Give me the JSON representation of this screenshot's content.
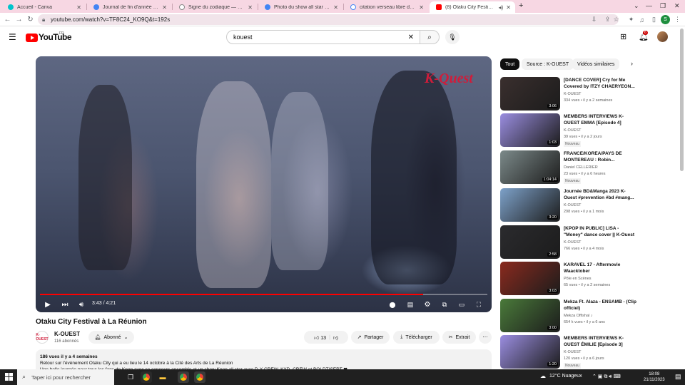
{
  "browser": {
    "tabs": [
      {
        "label": "Accueil - Canva",
        "color": "#00c4cc",
        "active": false
      },
      {
        "label": "Journal de fin d'année 2023 - Di",
        "color": "#4285f4",
        "active": false
      },
      {
        "label": "Signe du zodiaque — Wikipédia",
        "color": "#888888",
        "active": false
      },
      {
        "label": "Photo du show all star kpop - k",
        "color": "#4285f4",
        "active": false
      },
      {
        "label": "citation verseau libre de droit - ",
        "color": "#34a853",
        "active": false
      },
      {
        "label": "(8) Otaku City Festival à La R",
        "color": "#ff0000",
        "active": true
      }
    ],
    "new_tab": "+",
    "url": "youtube.com/watch?v=TF8C24_KO9Q&t=192s",
    "profile_initial": "S"
  },
  "youtube": {
    "logo_text": "YouTube",
    "logo_country": "FR",
    "search_value": "kouest",
    "notification_count": "6",
    "player": {
      "watermark": "K-Quest",
      "time": "3:43 / 4:21",
      "progress_fraction": 0.856
    },
    "video_title": "Otaku City Festival à La Réunion",
    "channel": {
      "avatar_text": "K-OUEST",
      "name": "K-OUEST",
      "subscribers": "116 abonnés",
      "subscribe_label": "Abonné"
    },
    "actions": {
      "likes": "13",
      "share": "Partager",
      "download": "Télécharger",
      "clip": "Extrait"
    },
    "description": {
      "meta": "186 vues  il y a 4 semaines",
      "line1": "Retour sur l'évènement Otaku City qui a eu lieu le 14 octobre à la Cité des Arts de La Réunion",
      "line2": "Une belle journée pour tous les fans de Kpop avec ce concours ensemble et un show Kpop all star avec D-X CREW, KXD, CREW et BOLDTISERT ❤"
    },
    "chips": [
      "Tout",
      "Source : K-OUEST",
      "Vidéos similaires"
    ],
    "recommendations": [
      {
        "title": "[DANCE COVER] Cry for Me Covered by ITZY CHAERYEON...",
        "channel": "K-OUEST",
        "meta": "334 vues • il y a 2 semaines",
        "duration": "3:06",
        "badge": "",
        "thumb": "#3a2f2e"
      },
      {
        "title": "MEMBERS INTERVIEWS K-OUEST EMMA [Episode 4]",
        "channel": "K-OUEST",
        "meta": "39 vues • il y a 2 jours",
        "duration": "1:03",
        "badge": "Nouveau",
        "thumb": "#9a8de0"
      },
      {
        "title": "FRANCE/KOREA/PAYS DE MONTEREAU : Robin...",
        "channel": "Daniel CELLERIER",
        "meta": "23 vues • il y a 6 heures",
        "duration": "1:04:14",
        "badge": "Nouveau",
        "thumb": "#7c8a8a"
      },
      {
        "title": "Journée BD&Manga 2023 K-Ouest #prevention #bd #mang...",
        "channel": "K-OUEST",
        "meta": "298 vues • il y a 1 mois",
        "duration": "3:20",
        "badge": "",
        "thumb": "#7da1c9"
      },
      {
        "title": "[KPOP IN PUBLIC] LISA - \"Money\" dance cover || K-Ouest",
        "channel": "K-OUEST",
        "meta": "766 vues • il y a 4 mois",
        "duration": "2:58",
        "badge": "",
        "thumb": "#2b2b2e"
      },
      {
        "title": "KARAVEL 17 - Aftermovie Waacktober",
        "channel": "Pôle en Scènes",
        "meta": "65 vues • il y a 2 semaines",
        "duration": "3:03",
        "badge": "",
        "thumb": "#8a2a1e"
      },
      {
        "title": "Mekza Ft. Alaza - ENSAMB - (Clip officiel)",
        "channel": "Mekza Offishal ♪",
        "meta": "654 k vues • il y a 6 ans",
        "duration": "3:00",
        "badge": "",
        "thumb": "#4a7a3a"
      },
      {
        "title": "MEMBERS INTERVIEWS K-OUEST ÉMILIE [Episode 3]",
        "channel": "K-OUEST",
        "meta": "120 vues • il y a 6 jours",
        "duration": "1:20",
        "badge": "Nouveau",
        "thumb": "#9a8de0"
      }
    ]
  },
  "taskbar": {
    "search_placeholder": "Taper ici pour rechercher",
    "weather": "12°C  Nuageux",
    "time": "18:08",
    "date": "21/11/2023"
  }
}
